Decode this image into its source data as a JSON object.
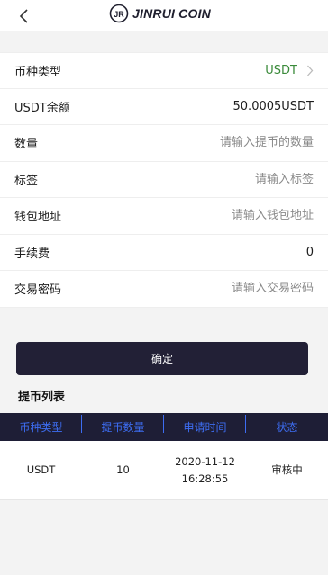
{
  "header": {
    "logo_text": "JINRUI COIN",
    "logo_mark": "JR"
  },
  "form": {
    "currency_type": {
      "label": "币种类型",
      "value": "USDT"
    },
    "balance": {
      "label": "USDT余额",
      "value": "50.0005USDT"
    },
    "quantity": {
      "label": "数量",
      "placeholder": "请输入提币的数量"
    },
    "tag": {
      "label": "标签",
      "placeholder": "请输入标签"
    },
    "wallet_address": {
      "label": "钱包地址",
      "placeholder": "请输入钱包地址"
    },
    "fee": {
      "label": "手续费",
      "value": "0"
    },
    "trade_password": {
      "label": "交易密码",
      "placeholder": "请输入交易密码"
    }
  },
  "confirm_label": "确定",
  "withdraw_list": {
    "title": "提币列表",
    "columns": [
      "币种类型",
      "提币数量",
      "申请时间",
      "状态"
    ],
    "rows": [
      {
        "currency": "USDT",
        "amount": "10",
        "date": "2020-11-12",
        "time": "16:28:55",
        "status": "审核中"
      }
    ]
  },
  "colors": {
    "accent_dark": "#222036",
    "table_header_bg": "#1e1e36",
    "table_header_text": "#3d6df2",
    "currency_green": "#3a8a3a"
  },
  "icons": {
    "back": "chevron-left-icon",
    "select": "chevron-right-icon",
    "logo": "jr-logo-icon"
  }
}
